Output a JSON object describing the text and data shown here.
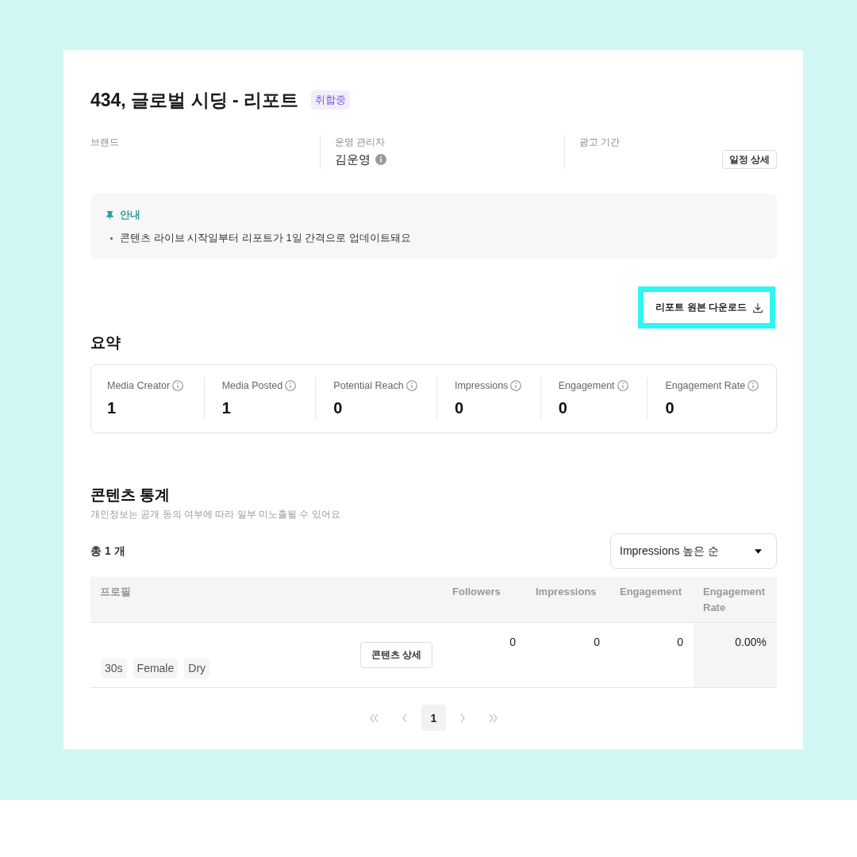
{
  "header": {
    "title": "434, 글로벌 시딩 - 리포트",
    "status_badge": "취합중"
  },
  "info_fields": [
    {
      "kind": "empty",
      "label": "브랜드"
    },
    {
      "kind": "person",
      "label": "운영 관리자",
      "value": "김운영"
    },
    {
      "kind": "action",
      "label": "광고 기간",
      "button": "일정 상세"
    }
  ],
  "notice": {
    "title": "안내",
    "items": [
      "콘텐츠 라이브 시작일부터 리포트가 1일 간격으로 업데이트돼요"
    ]
  },
  "download_button": {
    "label": "리포트 원본 다운로드"
  },
  "summary": {
    "heading": "요약",
    "metrics": [
      {
        "label": "Media Creator",
        "value": "1"
      },
      {
        "label": "Media Posted",
        "value": "1"
      },
      {
        "label": "Potential Reach",
        "value": "0"
      },
      {
        "label": "Impressions",
        "value": "0"
      },
      {
        "label": "Engagement",
        "value": "0"
      },
      {
        "label": "Engagement Rate",
        "value": "0"
      }
    ]
  },
  "content_stats": {
    "heading": "콘텐츠 통계",
    "subtitle": "개인정보는 공개 동의 여부에 따라 일부 미노출될 수 있어요",
    "total": "총 1 개",
    "sort_dropdown": {
      "value": "Impressions 높은 순"
    },
    "table": {
      "columns": [
        "프로필",
        "Followers",
        "Impressions",
        "Engagement",
        "Engagement Rate"
      ],
      "rows": [
        {
          "tags": [
            "30s",
            "Female",
            "Dry"
          ],
          "detail_button": "콘텐츠 상세",
          "values": [
            "0",
            "0",
            "0",
            "0.00%"
          ]
        }
      ]
    },
    "pagination": {
      "nav_back": [
        {
          "kind": "first",
          "disabled": true
        },
        {
          "kind": "prev",
          "disabled": true
        }
      ],
      "pages": [
        {
          "label": "1",
          "selected": true
        }
      ],
      "nav_forward": [
        {
          "kind": "next",
          "disabled": true
        },
        {
          "kind": "last",
          "disabled": true
        }
      ]
    }
  }
}
